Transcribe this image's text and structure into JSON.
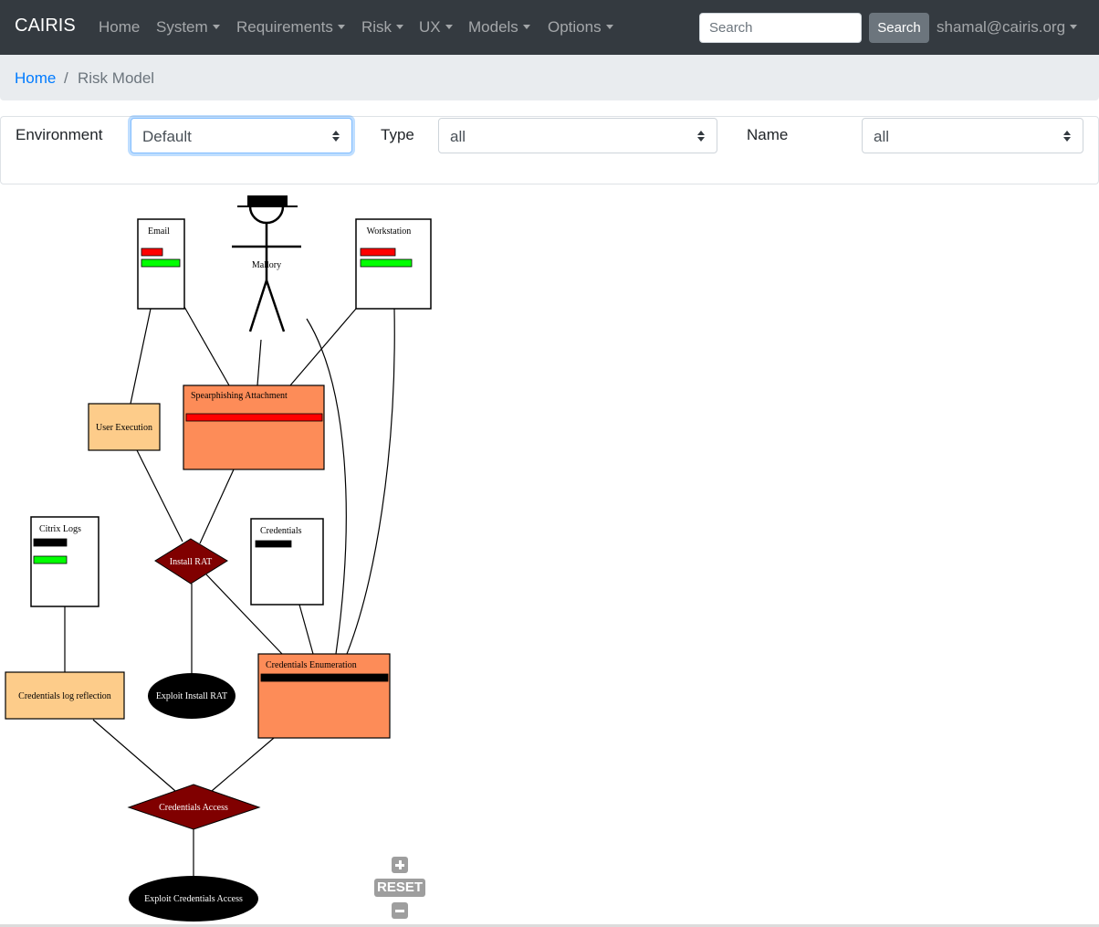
{
  "navbar": {
    "brand": "CAIRIS",
    "items": [
      {
        "label": "Home",
        "dropdown": false
      },
      {
        "label": "System",
        "dropdown": true
      },
      {
        "label": "Requirements",
        "dropdown": true
      },
      {
        "label": "Risk",
        "dropdown": true
      },
      {
        "label": "UX",
        "dropdown": true
      },
      {
        "label": "Models",
        "dropdown": true
      },
      {
        "label": "Options",
        "dropdown": true
      }
    ],
    "search_placeholder": "Search",
    "search_button": "Search",
    "user": "shamal@cairis.org"
  },
  "breadcrumb": {
    "home": "Home",
    "separator": "/",
    "current": "Risk Model"
  },
  "filters": {
    "environment_label": "Environment",
    "environment_value": "Default",
    "type_label": "Type",
    "type_value": "all",
    "name_label": "Name",
    "name_value": "all"
  },
  "colors": {
    "threat_fill": "#fd8c58",
    "vulnerability_fill": "#fdcc8a",
    "risk_fill": "#800000",
    "misuse_fill": "#000000",
    "asset_fill": "#ffffff",
    "bar_red": "#ff0000",
    "bar_green": "#00ff00",
    "bar_black": "#000000"
  },
  "model": {
    "attacker": {
      "label": "Mallory"
    },
    "assets": [
      {
        "id": "email",
        "label": "Email",
        "bars": [
          {
            "color": "red",
            "fraction": 0.55
          },
          {
            "color": "green",
            "fraction": 1.0
          }
        ]
      },
      {
        "id": "workstation",
        "label": "Workstation",
        "bars": [
          {
            "color": "red",
            "fraction": 0.68
          },
          {
            "color": "green",
            "fraction": 1.0
          }
        ]
      },
      {
        "id": "citrix-logs",
        "label": "Citrix Logs",
        "bars": [
          {
            "color": "black",
            "fraction": 1.0
          },
          {
            "color": "green",
            "fraction": 1.0
          }
        ]
      },
      {
        "id": "credentials",
        "label": "Credentials",
        "bars": [
          {
            "color": "black",
            "fraction": 1.0
          }
        ]
      }
    ],
    "threats": [
      {
        "id": "spearphishing",
        "label": "Spearphishing Attachment",
        "bar": {
          "color": "red",
          "fraction": 1.0
        }
      },
      {
        "id": "cred-enum",
        "label": "Credentials Enumeration",
        "bar": {
          "color": "black",
          "fraction": 1.0
        }
      }
    ],
    "vulnerabilities": [
      {
        "id": "user-exec",
        "label": "User Execution"
      },
      {
        "id": "cred-log",
        "label": "Credentials log reflection"
      }
    ],
    "risks": [
      {
        "id": "install-rat",
        "label": "Install RAT"
      },
      {
        "id": "cred-access",
        "label": "Credentials Access"
      }
    ],
    "misuse_cases": [
      {
        "id": "exploit-rat",
        "label": "Exploit Install RAT"
      },
      {
        "id": "exploit-cred",
        "label": "Exploit Credentials Access"
      }
    ],
    "edges": [
      [
        "email",
        "user-exec"
      ],
      [
        "email",
        "spearphishing"
      ],
      [
        "mallory",
        "spearphishing"
      ],
      [
        "workstation",
        "spearphishing"
      ],
      [
        "mallory",
        "cred-enum"
      ],
      [
        "workstation",
        "cred-enum"
      ],
      [
        "user-exec",
        "install-rat"
      ],
      [
        "spearphishing",
        "install-rat"
      ],
      [
        "install-rat",
        "exploit-rat"
      ],
      [
        "install-rat",
        "cred-enum"
      ],
      [
        "credentials",
        "cred-enum"
      ],
      [
        "citrix-logs",
        "cred-log"
      ],
      [
        "cred-log",
        "cred-access"
      ],
      [
        "cred-enum",
        "cred-access"
      ],
      [
        "cred-access",
        "exploit-cred"
      ]
    ]
  },
  "zoom_controls": {
    "zoom_in": "+",
    "reset": "RESET",
    "zoom_out": "−"
  }
}
